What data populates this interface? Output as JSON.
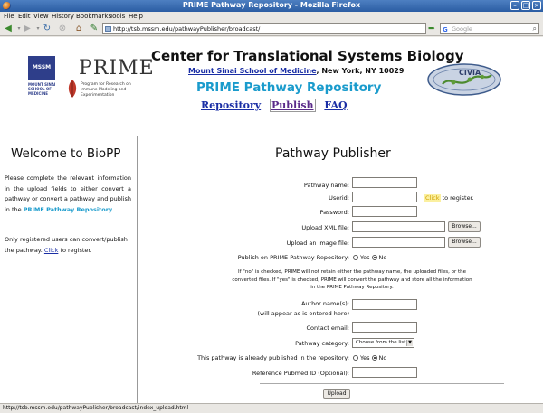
{
  "window": {
    "title": "PRIME Pathway Repository - Mozilla Firefox"
  },
  "menu": [
    "File",
    "Edit",
    "View",
    "History",
    "Bookmarks",
    "Tools",
    "Help"
  ],
  "toolbar": {
    "url": "http://tsb.mssm.edu/pathwayPublisher/broadcast/",
    "search_placeholder": "Google",
    "icons": [
      "back-icon",
      "forward-icon",
      "reload-icon",
      "stop-icon",
      "home-icon",
      "bookmark-icon"
    ]
  },
  "header": {
    "title": "Center for Translational Systems Biology",
    "institution_link": "Mount Sinai School of Medicine",
    "institution_rest": ", New York, NY 10029",
    "repository": "PRIME Pathway Repository",
    "nav": [
      "Repository",
      "Publish",
      "FAQ"
    ],
    "mssm_box": "MSSM",
    "mssm_text": "MOUNT SINAI SCHOOL OF MEDICINE",
    "prime_logo": "PRIME",
    "prime_sub": "Program for Research on Immune Modeling and Experimentation",
    "civia_logo": "CIVIA"
  },
  "left": {
    "heading": "Welcome to BioPP",
    "para1_a": "Please complete the relevant information in the upload fields to either convert a pathway or convert a pathway and publish in the ",
    "para1_prime": "PRIME Pathway Repository",
    "para1_b": ".",
    "para2_a": "Only registered users can convert/publish the pathway. ",
    "para2_link": "Click",
    "para2_b": " to register."
  },
  "form": {
    "heading": "Pathway Publisher",
    "pathway_name": "Pathway name:",
    "userid": "Userid:",
    "password": "Password:",
    "upload_xml": "Upload XML file:",
    "upload_image": "Upload an image file:",
    "browse": "Browse...",
    "publish_q": "Publish on PRIME Pathway Repository:",
    "yes": "Yes",
    "no": "No",
    "note": "If \"no\" is checked, PRIME will not retain either the pathway name, the uploaded files, or the converted files. If \"yes\" is checked, PRIME will convert the pathway and store all the information in the PRIME Pathway Repository.",
    "author_names": "Author name(s):",
    "author_hint": "(will appear as is entered here)",
    "contact_email": "Contact email:",
    "pathway_category": "Pathway category:",
    "category_value": "Choose from the list",
    "already_published": "This pathway is already published in the repository:",
    "pubmed": "Reference Pubmed ID (Optional):",
    "upload": "Upload",
    "register_link": "Click",
    "register_rest": "to register."
  },
  "status": "http://tsb.mssm.edu/pathwayPublisher/broadcast/index_upload.html"
}
